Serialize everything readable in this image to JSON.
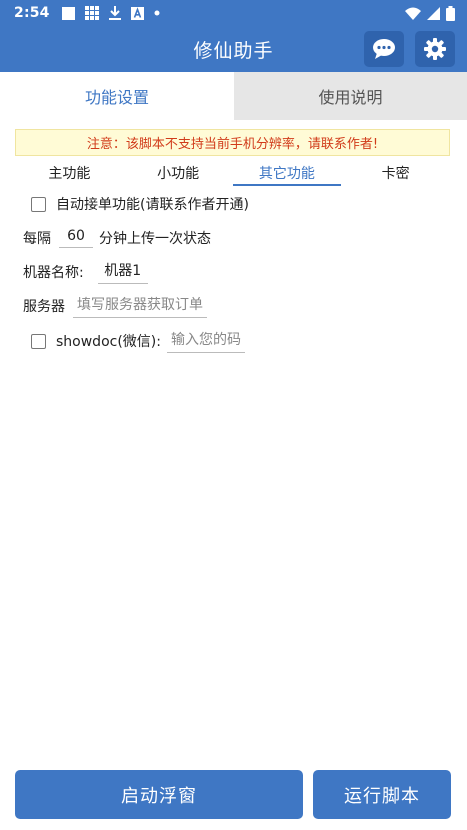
{
  "status_bar": {
    "time": "2:54",
    "icons": [
      "square-icon",
      "grid-icon",
      "download-icon",
      "a-box-icon",
      "dot-icon"
    ],
    "right_icons": [
      "wifi-icon",
      "signal-icon",
      "battery-icon"
    ]
  },
  "app_bar": {
    "title": "修仙助手",
    "buttons": [
      "chat-icon",
      "gear-icon"
    ]
  },
  "tabs": [
    {
      "label": "功能设置",
      "active": true
    },
    {
      "label": "使用说明",
      "active": false
    }
  ],
  "notice": "注意：该脚本不支持当前手机分辨率，请联系作者!",
  "sub_tabs": [
    {
      "label": "主功能",
      "active": false
    },
    {
      "label": "小功能",
      "active": false
    },
    {
      "label": "其它功能",
      "active": true
    },
    {
      "label": "卡密",
      "active": false
    }
  ],
  "form": {
    "auto_order": {
      "label": "自动接单功能(请联系作者开通)",
      "checked": false
    },
    "interval": {
      "prefix": "每隔",
      "value": "60",
      "suffix": "分钟上传一次状态"
    },
    "machine_name": {
      "label": "机器名称:",
      "value": "机器1"
    },
    "server": {
      "label": "服务器",
      "placeholder": "填写服务器获取订单"
    },
    "showdoc": {
      "label": "showdoc(微信):",
      "placeholder": "输入您的码",
      "checked": false
    }
  },
  "buttons": {
    "float_window": "启动浮窗",
    "run_script": "运行脚本"
  },
  "colors": {
    "primary": "#3f77c4",
    "notice_bg": "#fffbd6",
    "notice_text": "#d13b1a",
    "inactive_tab": "#e6e6e6"
  }
}
